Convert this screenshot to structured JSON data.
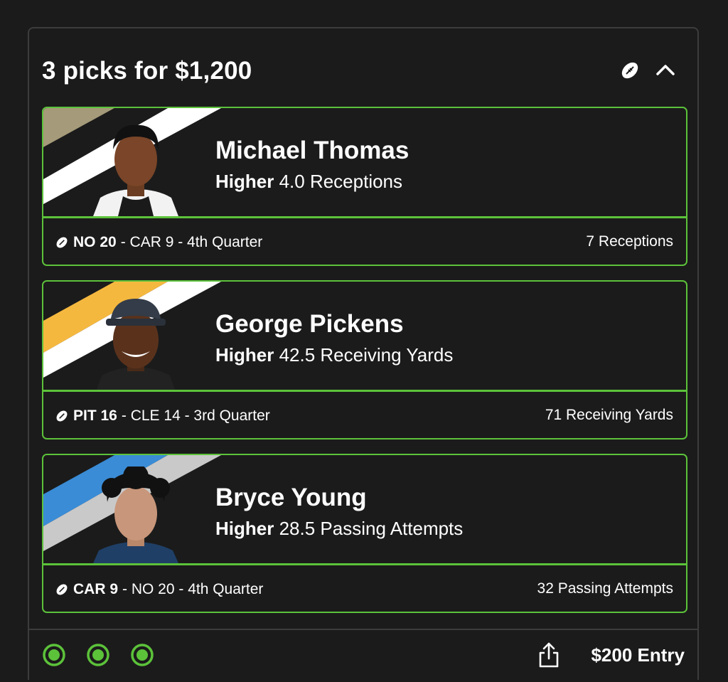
{
  "header": {
    "title": "3 picks for $1,200"
  },
  "picks": [
    {
      "name": "Michael Thomas",
      "direction": "Higher",
      "line": "4.0 Receptions",
      "team_score": "NO 20",
      "rest_score": "- CAR 9 - 4th Quarter",
      "result": "7 Receptions",
      "stripe_colors": [
        "#a59a79",
        "#ffffff"
      ]
    },
    {
      "name": "George Pickens",
      "direction": "Higher",
      "line": "42.5 Receiving Yards",
      "team_score": "PIT 16",
      "rest_score": "- CLE 14 - 3rd Quarter",
      "result": "71 Receiving Yards",
      "stripe_colors": [
        "#f5b83f",
        "#ffffff"
      ]
    },
    {
      "name": "Bryce Young",
      "direction": "Higher",
      "line": "28.5 Passing Attempts",
      "team_score": "CAR 9",
      "rest_score": "- NO 20 - 4th Quarter",
      "result": "32 Passing Attempts",
      "stripe_colors": [
        "#3a8cd6",
        "#c9c9c9"
      ]
    }
  ],
  "footer": {
    "entry": "$200 Entry"
  },
  "colors": {
    "accent": "#5cc23a",
    "background": "#1b1b1b",
    "border": "#3c3c3c"
  },
  "icons": [
    "football-icon",
    "chevron-up-icon",
    "check-circle-icon",
    "share-icon"
  ]
}
